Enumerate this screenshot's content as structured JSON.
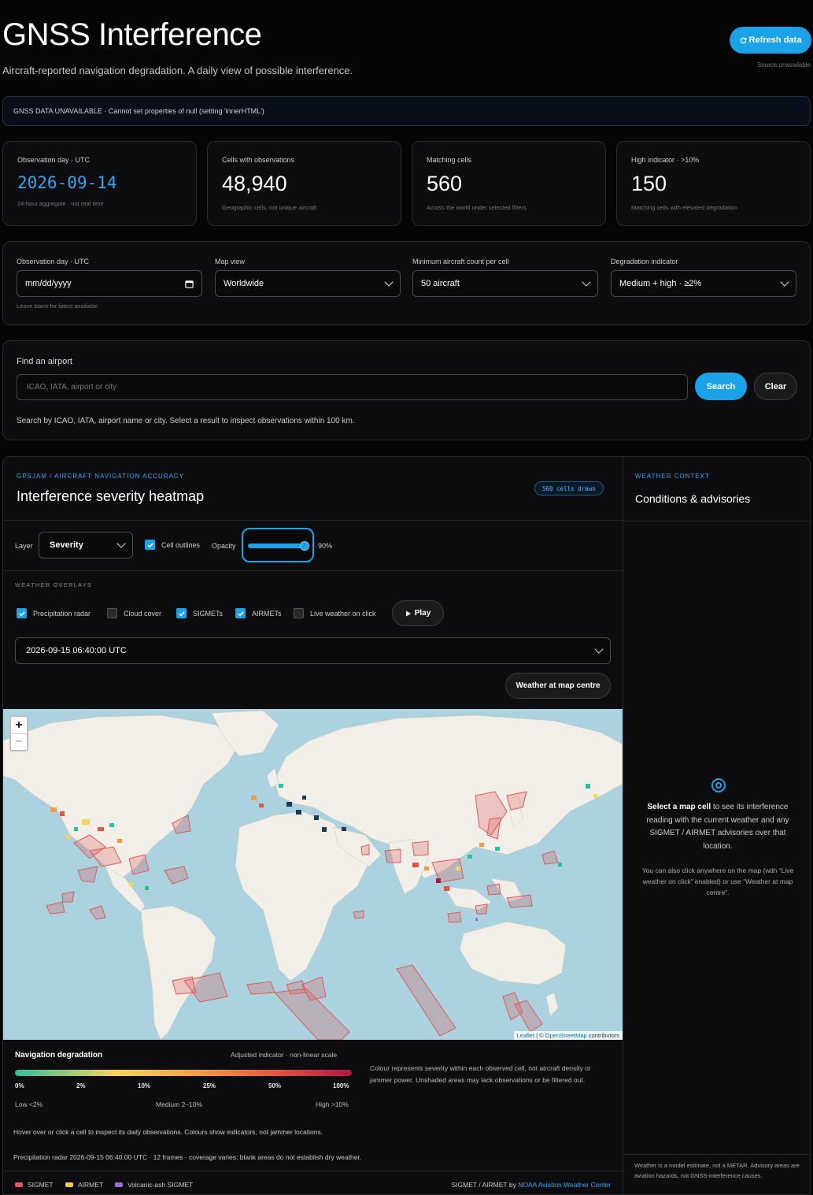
{
  "header": {
    "title": "GNSS Interference",
    "subtitle": "Aircraft-reported navigation degradation. A daily view of possible interference.",
    "refresh_label": "Refresh data",
    "refresh_icon": "refresh-icon",
    "source_note": "Source unavailable"
  },
  "alert": {
    "text": "GNSS DATA UNAVAILABLE · Cannot set properties of null (setting 'innerHTML')"
  },
  "stats": [
    {
      "label": "Observation day · UTC",
      "value": "2026-09-14",
      "sub": "24-hour aggregate · not real time"
    },
    {
      "label": "Cells with observations",
      "value": "48,940",
      "sub": "Geographic cells, not unique aircraft"
    },
    {
      "label": "Matching cells",
      "value": "560",
      "sub": "Across the world under selected filters"
    },
    {
      "label": "High indicator · >10%",
      "value": "150",
      "sub": "Matching cells with elevated degradation"
    }
  ],
  "filters": {
    "day": {
      "label": "Observation day · UTC",
      "placeholder": "mm/dd/yyyy",
      "hint": "Leave blank for latest available"
    },
    "view": {
      "label": "Map view",
      "value": "Worldwide"
    },
    "min_aircraft": {
      "label": "Minimum aircraft count per cell",
      "value": "50 aircraft"
    },
    "indicator": {
      "label": "Degradation indicator",
      "value": "Medium + high · ≥2%"
    }
  },
  "airport": {
    "label": "Find an airport",
    "placeholder": "ICAO, IATA, airport or city",
    "search_label": "Search",
    "clear_label": "Clear",
    "help": "Search by ICAO, IATA, airport name or city. Select a result to inspect observations within 100 km."
  },
  "heatmap": {
    "kicker": "GPSJAM / AIRCRAFT NAVIGATION ACCURACY",
    "title": "Interference severity heatmap",
    "badge": "560 cells drawn",
    "layer_label": "Layer",
    "layer_value": "Severity",
    "cell_outlines_label": "Cell outlines",
    "cell_outlines_checked": true,
    "opacity_label": "Opacity",
    "opacity_value": 0.9,
    "opacity_text": "90%"
  },
  "weather_overlays": {
    "title": "WEATHER OVERLAYS",
    "options": [
      {
        "label": "Precipitation radar",
        "checked": true
      },
      {
        "label": "Cloud cover",
        "checked": false
      },
      {
        "label": "SIGMETs",
        "checked": true
      },
      {
        "label": "AIRMETs",
        "checked": true
      },
      {
        "label": "Live weather on click",
        "checked": false
      }
    ],
    "play_label": "Play",
    "play_icon": "play-icon",
    "time_value": "2026-09-15 06:40:00 UTC",
    "map_centre_label": "Weather at map centre"
  },
  "map": {
    "zoom_in": "+",
    "zoom_out": "−",
    "attribution_leaflet": "Leaflet",
    "attribution_sep": " | © ",
    "attribution_osm": "OpenStreetMap",
    "attribution_tail": " contributors",
    "colors": {
      "ocean": "#aad3df",
      "land": "#f2efe9",
      "sigmet": "#e05a5a",
      "airmet": "#f1c84b",
      "ash": "#a06ad8"
    }
  },
  "legend": {
    "title": "Navigation degradation",
    "adjusted": "Adjusted indicator · non-linear scale",
    "ticks": [
      "0%",
      "2%",
      "10%",
      "25%",
      "50%",
      "100%"
    ],
    "levels": [
      "Low <2%",
      "Medium 2–10%",
      "High >10%"
    ],
    "note": "Colour represents severity within each observed cell, not aircraft density or jammer power. Unshaded areas may lack observations or be filtered out.",
    "hover_note": "Hover over or click a cell to inspect its daily observations. Colours show indicators, not jammer locations.",
    "radar_note": "Precipitation radar 2026-09-15 06:40:00 UTC · 12 frames · coverage varies; blank areas do not establish dry weather.",
    "keys": [
      {
        "label": "SIGMET",
        "color": "#e05a5a"
      },
      {
        "label": "AIRMET",
        "color": "#f1c84b"
      },
      {
        "label": "Volcanic-ash SIGMET",
        "color": "#a06ad8"
      }
    ],
    "credit_prefix": "SIGMET / AIRMET by ",
    "credit_link": "NOAA Aviation Weather Center"
  },
  "weather_context": {
    "kicker": "WEATHER CONTEXT",
    "title": "Conditions & advisories",
    "prompt_bold": "Select a map cell",
    "prompt_rest": " to see its interference reading with the current weather and any SIGMET / AIRMET advisories over that location.",
    "sub": "You can also click anywhere on the map (with “Live weather on click” enabled) or use “Weather at map centre”.",
    "footer": "Weather is a model estimate, not a METAR. Advisory areas are aviation hazards, not GNSS-interference causes."
  }
}
